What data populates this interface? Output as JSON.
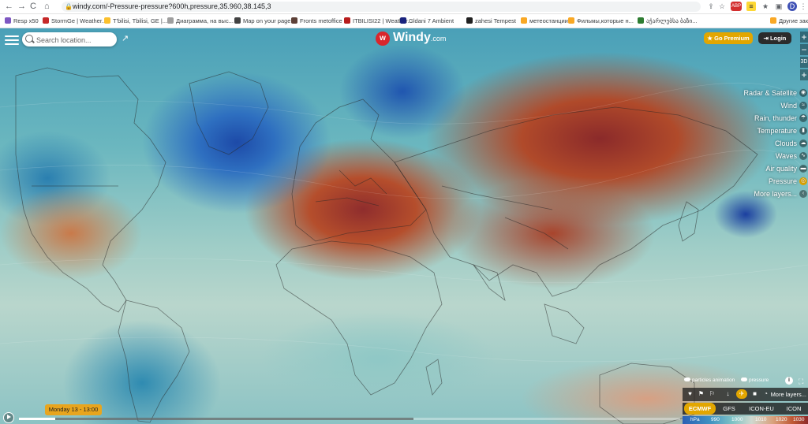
{
  "browser": {
    "url": "windy.com/-Pressure-pressure?600h,pressure,35.960,38.145,3",
    "nav": [
      "←",
      "→",
      "C",
      "⌂"
    ],
    "extensions": [
      "⇪",
      "☆",
      "ABP",
      "≡",
      "★",
      "▣",
      "D"
    ],
    "bookmarks": [
      {
        "label": "Resp x50",
        "color": "#7e57c2"
      },
      {
        "label": "StormGe | Weather...",
        "color": "#c62828"
      },
      {
        "label": "T'bilisi, Tbilisi, GE |...",
        "color": "#fbc02d"
      },
      {
        "label": "Диаграмма, на выс...",
        "color": "#9e9e9e"
      },
      {
        "label": "Map on your page",
        "color": "#424242"
      },
      {
        "label": "Fronts metoffice",
        "color": "#5d4037"
      },
      {
        "label": "ITBILISI22 | Weather...",
        "color": "#b71c1c"
      },
      {
        "label": "Gldani 7 Ambient",
        "color": "#1a237e"
      },
      {
        "label": "zahesi Tempest",
        "color": "#212121"
      },
      {
        "label": "метеостанции",
        "color": "#f9a825"
      },
      {
        "label": "Фильмы,которые н...",
        "color": "#f9a825"
      },
      {
        "label": "აჭარლებსა ბაზი...",
        "color": "#2e7d32"
      },
      {
        "label": "Другие закладк",
        "color": "#f9a825"
      }
    ]
  },
  "topbar": {
    "search_placeholder": "Search location...",
    "logo_text": "Windy",
    "logo_suffix": ".com",
    "premium_label": "Go Premium",
    "login_label": "Login",
    "zoom": [
      "+",
      "−",
      "3D",
      "+"
    ]
  },
  "layers": [
    {
      "label": "Radar & Satellite",
      "icon": "satellite-icon",
      "glyph": "◉",
      "active": false
    },
    {
      "label": "Wind",
      "icon": "wind-icon",
      "glyph": "≈",
      "active": false
    },
    {
      "label": "Rain, thunder",
      "icon": "rain-icon",
      "glyph": "☂",
      "active": false
    },
    {
      "label": "Temperature",
      "icon": "thermometer-icon",
      "glyph": "▮",
      "active": false
    },
    {
      "label": "Clouds",
      "icon": "cloud-icon",
      "glyph": "☁",
      "active": false
    },
    {
      "label": "Waves",
      "icon": "waves-icon",
      "glyph": "∿",
      "active": false
    },
    {
      "label": "Air quality",
      "icon": "car-icon",
      "glyph": "▬",
      "active": false
    },
    {
      "label": "Pressure",
      "icon": "pressure-icon",
      "glyph": "◎",
      "active": true
    },
    {
      "label": "More layers...",
      "icon": "chevron-left-icon",
      "glyph": "‹",
      "active": false
    }
  ],
  "timeline": {
    "label": "Monday 13 - 13:00"
  },
  "bottom": {
    "toggles": [
      "particles animation",
      "pressure"
    ],
    "info": "i",
    "fullscreen": "⛶",
    "tools": [
      {
        "name": "heart-icon",
        "glyph": "♥",
        "on": false
      },
      {
        "name": "flag-icon",
        "glyph": "⚑",
        "on": false
      },
      {
        "name": "flag-outline-icon",
        "glyph": "⚐",
        "on": false
      },
      {
        "name": "arrow-down-icon",
        "glyph": "↓",
        "on": false
      },
      {
        "name": "plane-icon",
        "glyph": "✈",
        "on": true
      },
      {
        "name": "camera-icon",
        "glyph": "■",
        "on": false
      },
      {
        "name": "radar-icon",
        "glyph": "◔",
        "on": false
      }
    ],
    "more_layers": "More layers...",
    "models": [
      "ECMWF",
      "GFS",
      "ICON-EU",
      "ICON"
    ],
    "active_model": "ECMWF",
    "scale": [
      "hPa",
      "990",
      "1000",
      "1010",
      "1020",
      "1030"
    ]
  }
}
